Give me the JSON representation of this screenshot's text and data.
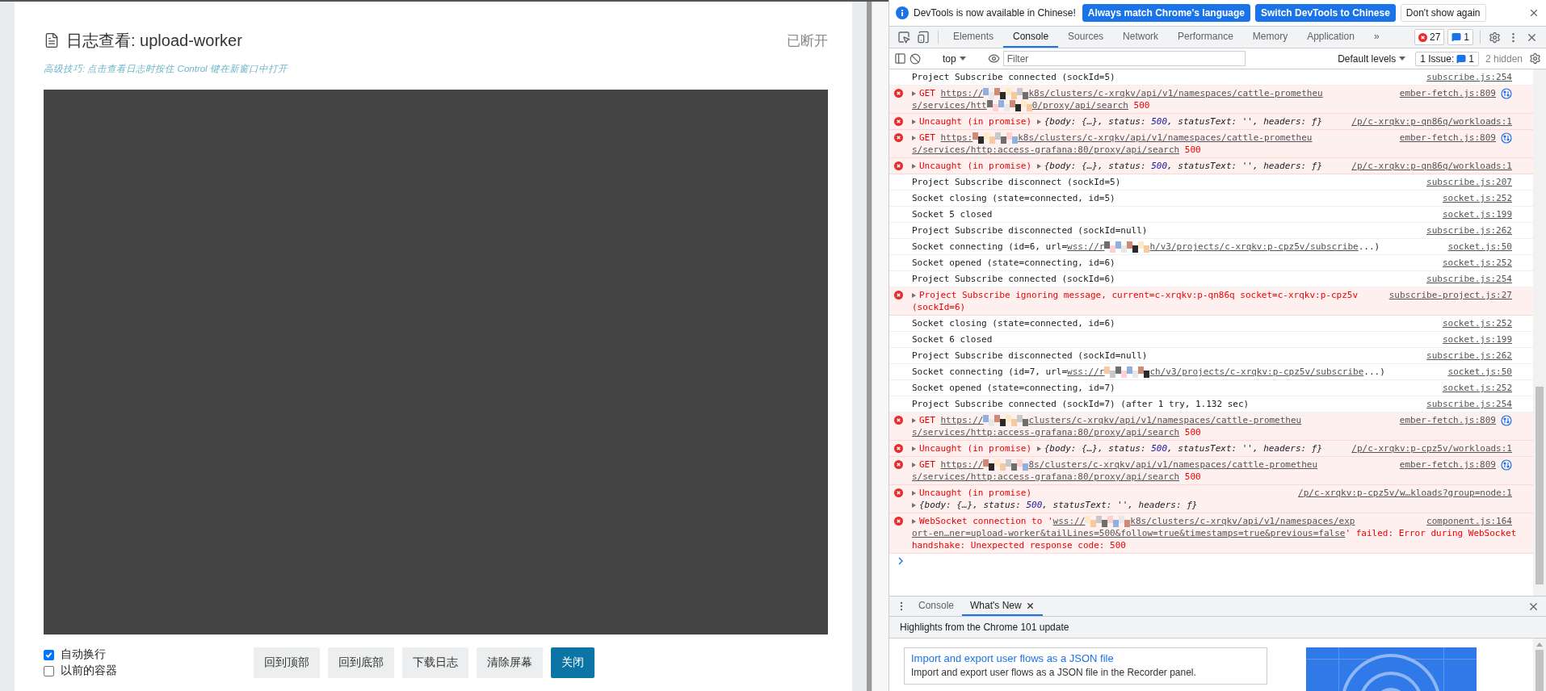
{
  "log_dialog": {
    "title": "日志查看: upload-worker",
    "status": "已断开",
    "hint": "高级技巧: 点击查看日志时按住 Control 键在新窗口中打开",
    "options": [
      {
        "label": "自动换行",
        "checked": true
      },
      {
        "label": "以前的容器",
        "checked": false
      }
    ],
    "buttons": [
      {
        "label": "回到顶部",
        "kind": "secondary"
      },
      {
        "label": "回到底部",
        "kind": "secondary"
      },
      {
        "label": "下载日志",
        "kind": "secondary"
      },
      {
        "label": "清除屏幕",
        "kind": "secondary"
      },
      {
        "label": "关闭",
        "kind": "primary"
      }
    ]
  },
  "devtools": {
    "infobar": {
      "message": "DevTools is now available in Chinese!",
      "buttons": [
        {
          "label": "Always match Chrome's language",
          "kind": "primary"
        },
        {
          "label": "Switch DevTools to Chinese",
          "kind": "primary"
        },
        {
          "label": "Don't show again",
          "kind": "secondary"
        }
      ]
    },
    "tabs": [
      {
        "label": "Elements",
        "selected": false
      },
      {
        "label": "Console",
        "selected": true
      },
      {
        "label": "Sources",
        "selected": false
      },
      {
        "label": "Network",
        "selected": false
      },
      {
        "label": "Performance",
        "selected": false
      },
      {
        "label": "Memory",
        "selected": false
      },
      {
        "label": "Application",
        "selected": false
      }
    ],
    "overflow": "»",
    "error_count": "27",
    "message_count": "1",
    "console_toolbar": {
      "context": "top",
      "filter_placeholder": "Filter",
      "levels": "Default levels",
      "issues_label": "1 Issue:",
      "issues_count": "1",
      "hidden": "2 hidden"
    },
    "messages": [
      {
        "kind": "log",
        "source": "subscribe.js:254",
        "lines": [
          [
            {
              "kind": "text",
              "text": "Project Subscribe connected (sockId=5)"
            }
          ]
        ]
      },
      {
        "kind": "error",
        "source": "ember-fetch.js:809",
        "network": true,
        "lines": [
          [
            {
              "kind": "toggle"
            },
            {
              "kind": "text",
              "text": "GET "
            },
            {
              "kind": "link",
              "text": "https://"
            },
            {
              "kind": "mosaic"
            },
            {
              "kind": "link",
              "text": "k8s/clusters/c-xrqkv/api/v1/namespaces/cattle-prometheu"
            }
          ],
          [
            {
              "kind": "link",
              "text": "s/services/htt"
            },
            {
              "kind": "mosaic"
            },
            {
              "kind": "link",
              "text": "0/proxy/api/search"
            },
            {
              "kind": "text",
              "text": " 500"
            }
          ]
        ]
      },
      {
        "kind": "error",
        "source": "/p/c-xrqkv:p-qn86q/workloads:1",
        "lines": [
          [
            {
              "kind": "toggle"
            },
            {
              "kind": "text",
              "text": "Uncaught (in promise) "
            },
            {
              "kind": "toggle"
            },
            {
              "kind": "object",
              "text": "{body: {…}, status: "
            },
            {
              "kind": "number",
              "text": "500"
            },
            {
              "kind": "object",
              "text": ", statusText: '', headers: ƒ}"
            }
          ]
        ]
      },
      {
        "kind": "error",
        "source": "ember-fetch.js:809",
        "network": true,
        "lines": [
          [
            {
              "kind": "toggle"
            },
            {
              "kind": "text",
              "text": "GET "
            },
            {
              "kind": "link",
              "text": "https:"
            },
            {
              "kind": "mosaic"
            },
            {
              "kind": "link",
              "text": "k8s/clusters/c-xrqkv/api/v1/namespaces/cattle-prometheu"
            }
          ],
          [
            {
              "kind": "link",
              "text": "s/services/http:access-grafana:80/proxy/api/search"
            },
            {
              "kind": "text",
              "text": " 500"
            }
          ]
        ]
      },
      {
        "kind": "error",
        "source": "/p/c-xrqkv:p-qn86q/workloads:1",
        "lines": [
          [
            {
              "kind": "toggle"
            },
            {
              "kind": "text",
              "text": "Uncaught (in promise) "
            },
            {
              "kind": "toggle"
            },
            {
              "kind": "object",
              "text": "{body: {…}, status: "
            },
            {
              "kind": "number",
              "text": "500"
            },
            {
              "kind": "object",
              "text": ", statusText: '', headers: ƒ}"
            }
          ]
        ]
      },
      {
        "kind": "log",
        "source": "subscribe.js:207",
        "lines": [
          [
            {
              "kind": "text",
              "text": "Project Subscribe disconnect (sockId=5)"
            }
          ]
        ]
      },
      {
        "kind": "log",
        "source": "socket.js:252",
        "lines": [
          [
            {
              "kind": "text",
              "text": "Socket closing (state=connected, id=5)"
            }
          ]
        ]
      },
      {
        "kind": "log",
        "source": "socket.js:199",
        "lines": [
          [
            {
              "kind": "text",
              "text": "Socket 5 closed"
            }
          ]
        ]
      },
      {
        "kind": "log",
        "source": "subscribe.js:262",
        "lines": [
          [
            {
              "kind": "text",
              "text": "Project Subscribe disconnected (sockId=null)"
            }
          ]
        ]
      },
      {
        "kind": "log",
        "source": "socket.js:50",
        "lines": [
          [
            {
              "kind": "text",
              "text": "Socket connecting (id=6, url="
            },
            {
              "kind": "link",
              "text": "wss://r"
            },
            {
              "kind": "mosaic"
            },
            {
              "kind": "link",
              "text": "h/v3/projects/c-xrqkv:p-cpz5v/subscribe"
            },
            {
              "kind": "text",
              "text": "...)"
            }
          ]
        ]
      },
      {
        "kind": "log",
        "source": "socket.js:252",
        "lines": [
          [
            {
              "kind": "text",
              "text": "Socket opened (state=connecting, id=6)"
            }
          ]
        ]
      },
      {
        "kind": "log",
        "source": "subscribe.js:254",
        "lines": [
          [
            {
              "kind": "text",
              "text": "Project Subscribe connected (sockId=6)"
            }
          ]
        ]
      },
      {
        "kind": "error",
        "source": "subscribe-project.js:27",
        "lines": [
          [
            {
              "kind": "toggle"
            },
            {
              "kind": "text",
              "text": "Project Subscribe ignoring message, current=c-xrqkv:p-qn86q socket=c-xrqkv:p-cpz5v"
            }
          ],
          [
            {
              "kind": "text",
              "text": "(sockId=6)"
            }
          ]
        ]
      },
      {
        "kind": "log",
        "source": "socket.js:252",
        "lines": [
          [
            {
              "kind": "text",
              "text": "Socket closing (state=connected, id=6)"
            }
          ]
        ]
      },
      {
        "kind": "log",
        "source": "socket.js:199",
        "lines": [
          [
            {
              "kind": "text",
              "text": "Socket 6 closed"
            }
          ]
        ]
      },
      {
        "kind": "log",
        "source": "subscribe.js:262",
        "lines": [
          [
            {
              "kind": "text",
              "text": "Project Subscribe disconnected (sockId=null)"
            }
          ]
        ]
      },
      {
        "kind": "log",
        "source": "socket.js:50",
        "lines": [
          [
            {
              "kind": "text",
              "text": "Socket connecting (id=7, url="
            },
            {
              "kind": "link",
              "text": "wss://r"
            },
            {
              "kind": "mosaic"
            },
            {
              "kind": "link",
              "text": "ch/v3/projects/c-xrqkv:p-cpz5v/subscribe"
            },
            {
              "kind": "text",
              "text": "...)"
            }
          ]
        ]
      },
      {
        "kind": "log",
        "source": "socket.js:252",
        "lines": [
          [
            {
              "kind": "text",
              "text": "Socket opened (state=connecting, id=7)"
            }
          ]
        ]
      },
      {
        "kind": "log",
        "source": "subscribe.js:254",
        "lines": [
          [
            {
              "kind": "text",
              "text": "Project Subscribe connected (sockId=7) (after 1 try, 1.132 sec)"
            }
          ]
        ]
      },
      {
        "kind": "error",
        "source": "ember-fetch.js:809",
        "network": true,
        "lines": [
          [
            {
              "kind": "toggle"
            },
            {
              "kind": "text",
              "text": "GET "
            },
            {
              "kind": "link",
              "text": "https://"
            },
            {
              "kind": "mosaic"
            },
            {
              "kind": "link",
              "text": "clusters/c-xrqkv/api/v1/namespaces/cattle-prometheu"
            }
          ],
          [
            {
              "kind": "link",
              "text": "s/services/http:access-grafana:80/proxy/api/search"
            },
            {
              "kind": "text",
              "text": " 500"
            }
          ]
        ]
      },
      {
        "kind": "error",
        "source": "/p/c-xrqkv:p-cpz5v/workloads:1",
        "lines": [
          [
            {
              "kind": "toggle"
            },
            {
              "kind": "text",
              "text": "Uncaught (in promise) "
            },
            {
              "kind": "toggle"
            },
            {
              "kind": "object",
              "text": "{body: {…}, status: "
            },
            {
              "kind": "number",
              "text": "500"
            },
            {
              "kind": "object",
              "text": ", statusText: '', headers: ƒ}"
            }
          ]
        ]
      },
      {
        "kind": "error",
        "source": "ember-fetch.js:809",
        "network": true,
        "lines": [
          [
            {
              "kind": "toggle"
            },
            {
              "kind": "text",
              "text": "GET "
            },
            {
              "kind": "link",
              "text": "https://"
            },
            {
              "kind": "mosaic"
            },
            {
              "kind": "link",
              "text": "8s/clusters/c-xrqkv/api/v1/namespaces/cattle-prometheu"
            }
          ],
          [
            {
              "kind": "link",
              "text": "s/services/http:access-grafana:80/proxy/api/search"
            },
            {
              "kind": "text",
              "text": " 500"
            }
          ]
        ]
      },
      {
        "kind": "error",
        "source": "/p/c-xrqkv:p-cpz5v/w…kloads?group=node:1",
        "lines": [
          [
            {
              "kind": "toggle"
            },
            {
              "kind": "text",
              "text": "Uncaught (in promise)"
            }
          ],
          [
            {
              "kind": "toggle"
            },
            {
              "kind": "object",
              "text": "{body: {…}, status: "
            },
            {
              "kind": "number",
              "text": "500"
            },
            {
              "kind": "object",
              "text": ", statusText: '', headers: ƒ}"
            }
          ]
        ]
      },
      {
        "kind": "error",
        "source": "component.js:164",
        "lines": [
          [
            {
              "kind": "toggle"
            },
            {
              "kind": "text",
              "text": "WebSocket connection to '"
            },
            {
              "kind": "link",
              "text": "wss://"
            },
            {
              "kind": "mosaic"
            },
            {
              "kind": "link",
              "text": "k8s/clusters/c-xrqkv/api/v1/namespaces/exp"
            }
          ],
          [
            {
              "kind": "link",
              "text": "ort-en…ner=upload-worker&tailLines=500&follow=true&timestamps=true&previous=false"
            },
            {
              "kind": "text",
              "text": "' failed: Error during WebSocket"
            }
          ],
          [
            {
              "kind": "text",
              "text": "handshake: Unexpected response code: 500"
            }
          ]
        ]
      }
    ],
    "drawer": {
      "tabs": [
        {
          "label": "Console",
          "selected": false,
          "closable": false
        },
        {
          "label": "What's New",
          "selected": true,
          "closable": true
        }
      ],
      "heading": "Highlights from the Chrome 101 update",
      "feature": {
        "title": "Import and export user flows as a JSON file",
        "description": "Import and export user flows as a JSON file in the Recorder panel."
      }
    }
  }
}
